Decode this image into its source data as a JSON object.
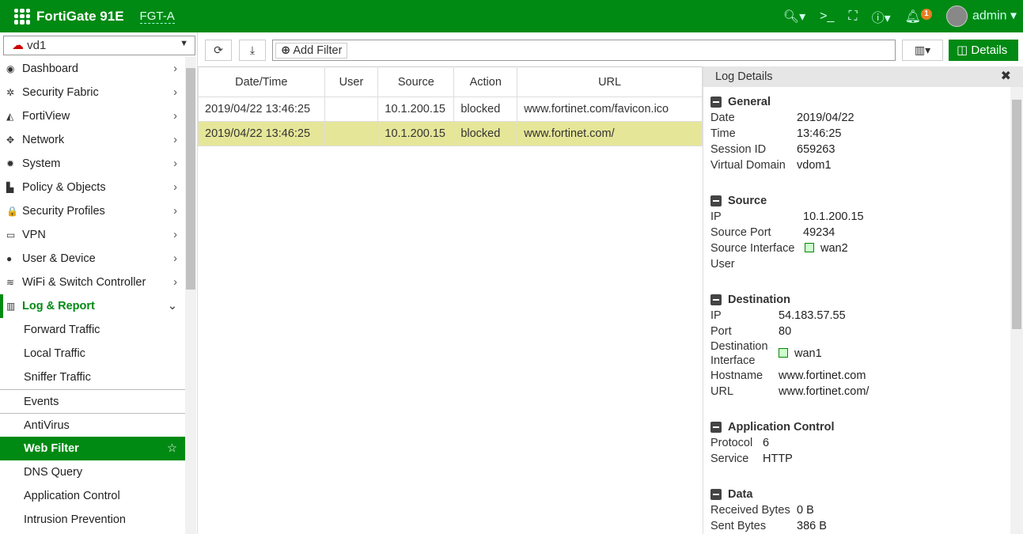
{
  "header": {
    "brand": "FortiGate 91E",
    "hostname": "FGT-A",
    "notif_count": "1",
    "user": "admin"
  },
  "vdom": "vd1",
  "nav": [
    {
      "label": "Dashboard",
      "icon": "dashboard-icon",
      "glyph": "◉"
    },
    {
      "label": "Security Fabric",
      "icon": "fabric-icon",
      "glyph": "✲"
    },
    {
      "label": "FortiView",
      "icon": "chart-icon",
      "glyph": "◭"
    },
    {
      "label": "Network",
      "icon": "network-icon",
      "glyph": "✥"
    },
    {
      "label": "System",
      "icon": "gear-icon",
      "glyph": "✹"
    },
    {
      "label": "Policy & Objects",
      "icon": "policy-icon",
      "glyph": "▙"
    },
    {
      "label": "Security Profiles",
      "icon": "lock-icon",
      "glyph": "🔒"
    },
    {
      "label": "VPN",
      "icon": "laptop-icon",
      "glyph": "▭"
    },
    {
      "label": "User & Device",
      "icon": "user-icon",
      "glyph": "●"
    },
    {
      "label": "WiFi & Switch Controller",
      "icon": "wifi-icon",
      "glyph": "≋"
    },
    {
      "label": "Log & Report",
      "icon": "report-icon",
      "glyph": "▥"
    }
  ],
  "log_sub": [
    "Forward Traffic",
    "Local Traffic",
    "Sniffer Traffic",
    "Events",
    "AntiVirus",
    "Web Filter",
    "DNS Query",
    "Application Control",
    "Intrusion Prevention"
  ],
  "toolbar": {
    "add_filter": "Add Filter",
    "details": "Details"
  },
  "table": {
    "columns": [
      "Date/Time",
      "User",
      "Source",
      "Action",
      "URL"
    ],
    "rows": [
      [
        "2019/04/22 13:46:25",
        "",
        "10.1.200.15",
        "blocked",
        "www.fortinet.com/favicon.ico"
      ],
      [
        "2019/04/22 13:46:25",
        "",
        "10.1.200.15",
        "blocked",
        "www.fortinet.com/"
      ]
    ]
  },
  "details": {
    "title": "Log Details",
    "general": {
      "title": "General",
      "date_l": "Date",
      "date": "2019/04/22",
      "time_l": "Time",
      "time": "13:46:25",
      "sid_l": "Session ID",
      "sid": "659263",
      "vd_l": "Virtual Domain",
      "vd": "vdom1"
    },
    "source": {
      "title": "Source",
      "ip_l": "IP",
      "ip": "10.1.200.15",
      "port_l": "Source Port",
      "port": "49234",
      "if_l": "Source Interface",
      "if": "wan2",
      "user_l": "User"
    },
    "dest": {
      "title": "Destination",
      "ip_l": "IP",
      "ip": "54.183.57.55",
      "port_l": "Port",
      "port": "80",
      "if_l1": "Destination",
      "if_l2": "Interface",
      "if": "wan1",
      "host_l": "Hostname",
      "host": "www.fortinet.com",
      "url_l": "URL",
      "url": "www.fortinet.com/"
    },
    "app": {
      "title": "Application Control",
      "proto_l": "Protocol",
      "proto": "6",
      "svc_l": "Service",
      "svc": "HTTP"
    },
    "data": {
      "title": "Data",
      "rx_l": "Received Bytes",
      "rx": "0 B",
      "tx_l": "Sent Bytes",
      "tx": "386 B"
    }
  }
}
